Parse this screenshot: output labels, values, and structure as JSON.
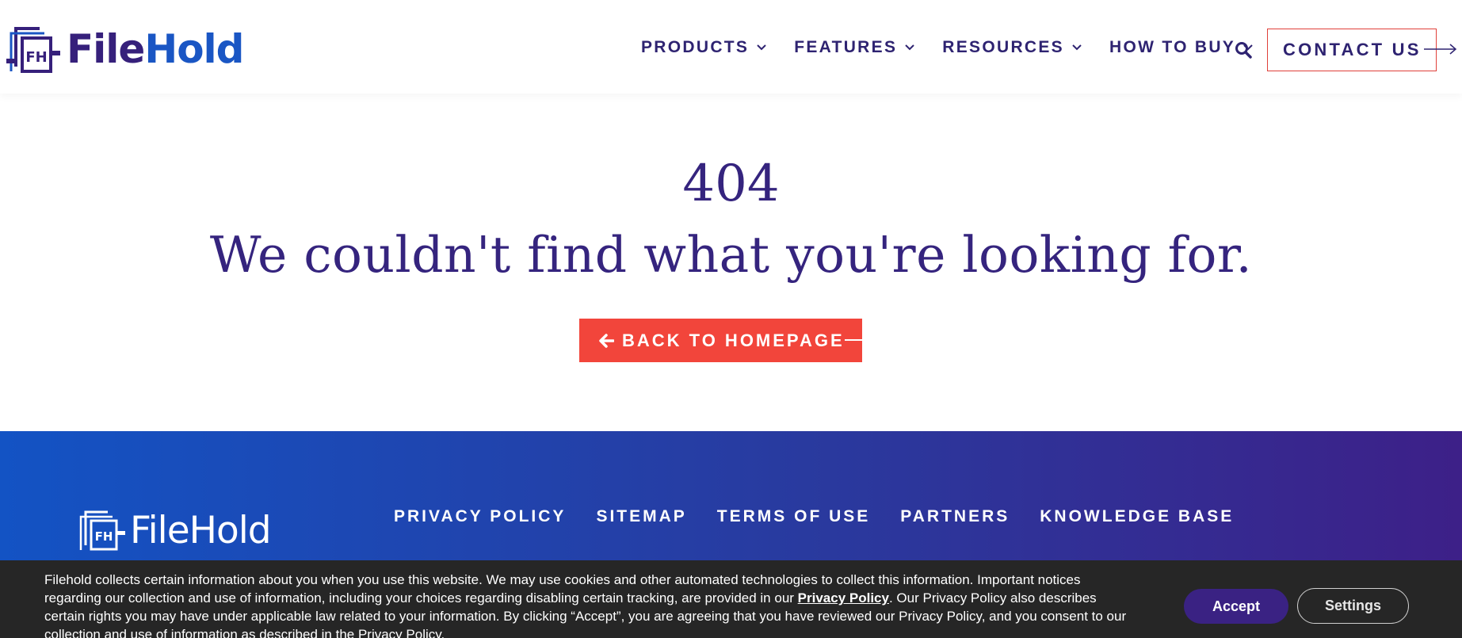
{
  "brand": {
    "logo_monogram": "FH",
    "name_part1": "File",
    "name_part2": "Hold",
    "footer_name": "FileHold",
    "colors": {
      "primary": "#36207b",
      "secondary": "#1a56c4",
      "accent": "#f2453b"
    }
  },
  "nav": {
    "items": [
      {
        "label": "PRODUCTS",
        "icon": "chevron-down-icon"
      },
      {
        "label": "FEATURES",
        "icon": "chevron-down-icon"
      },
      {
        "label": "RESOURCES",
        "icon": "chevron-down-icon"
      },
      {
        "label": "HOW TO BUY",
        "icon": "chevron-down-icon"
      }
    ],
    "search_icon": "search-icon",
    "contact_label": "CONTACT US"
  },
  "error": {
    "code": "404",
    "message": "We couldn't find what you're looking for.",
    "back_label": "BACK TO HOMEPAGE"
  },
  "footer": {
    "links": [
      "PRIVACY POLICY",
      "SITEMAP",
      "TERMS OF USE",
      "PARTNERS",
      "KNOWLEDGE BASE"
    ]
  },
  "cookie": {
    "text_before": "Filehold collects certain information about you when you use this website. We may use cookies and other automated technologies to collect this information. Important notices regarding our collection and use of information, including your choices regarding disabling certain tracking, are provided in our ",
    "link_label": "Privacy Policy",
    "text_after": ". Our Privacy Policy also describes certain rights you may have under applicable law related to your information. By clicking “Accept”, you are agreeing that you have reviewed our Privacy Policy, and you consent to our collection and use of information as described in the Privacy Policy.",
    "accept_label": "Accept",
    "settings_label": "Settings"
  }
}
